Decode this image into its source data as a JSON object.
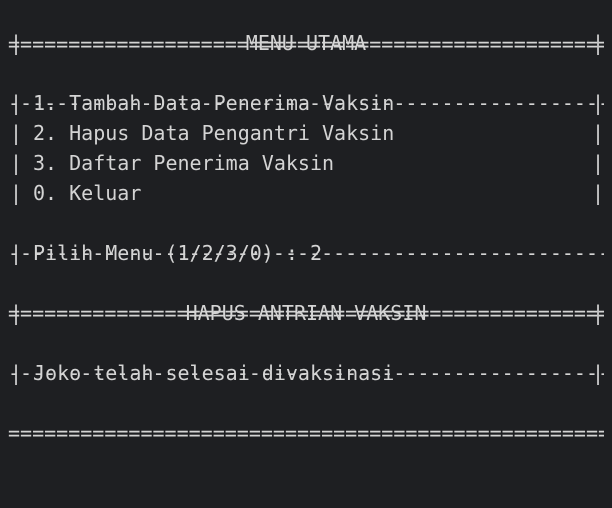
{
  "terminal": {
    "rule_double": "==================================================================================",
    "rule_single": "----------------------------------------------------------------------------------",
    "bar": "|",
    "menu_title": "MENU UTAMA",
    "menu_items": [
      "1. Tambah Data Penerima Vaksin",
      "2. Hapus Data Pengantri Vaksin",
      "3. Daftar Penerima Vaksin",
      "0. Keluar"
    ],
    "prompt_text": "Pilih Menu (1/2/3/0) : 2",
    "section_title": "HAPUS ANTRIAN VAKSIN",
    "result_message": "Joko telah selesai divaksinasi"
  },
  "colors": {
    "background": "#1e1f22",
    "foreground": "#d4d4d4"
  }
}
